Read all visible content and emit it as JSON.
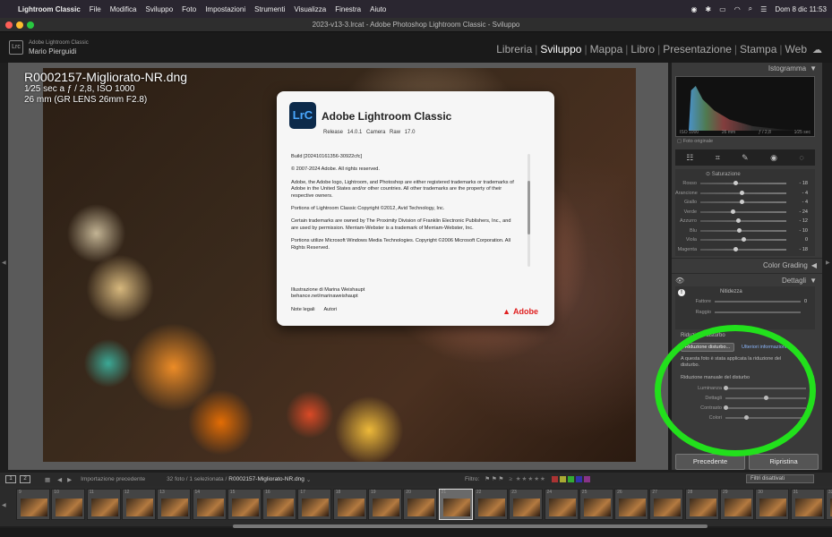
{
  "menubar": {
    "app": "Lightroom Classic",
    "items": [
      "File",
      "Modifica",
      "Sviluppo",
      "Foto",
      "Impostazioni",
      "Strumenti",
      "Visualizza",
      "Finestra",
      "Aiuto"
    ],
    "datetime": "Dom 8 dic  11:53"
  },
  "window": {
    "title": "2023-v13-3.lrcat - Adobe Photoshop Lightroom Classic - Sviluppo"
  },
  "identity": {
    "app_name": "Adobe Lightroom Classic",
    "user": "Mario Pierguidi",
    "logo": "Lrc"
  },
  "modules": [
    "Libreria",
    "Sviluppo",
    "Mappa",
    "Libro",
    "Presentazione",
    "Stampa",
    "Web"
  ],
  "active_module": "Sviluppo",
  "photo": {
    "filename": "R0002157-Migliorato-NR.dng",
    "exposure": "1⁄25 sec a ƒ / 2,8, ISO 1000",
    "lens": "26 mm (GR LENS 26mm F2.8)"
  },
  "about_dialog": {
    "icon_text": "LrC",
    "title": "Adobe Lightroom Classic",
    "release": "Release 14.0.1",
    "camera_raw": "Camera Raw 17.0",
    "paragraphs": [
      "Build [202410161356-30922cfc]",
      "© 2007-2024 Adobe. All rights reserved.",
      "Adobe, the Adobe logo, Lightroom, and Photoshop are either registered trademarks or trademarks of Adobe in the United States and/or other countries. All other trademarks are the property of their respective owners.",
      "Portions of Lightroom Classic Copyright ©2012, Avid Technology, Inc.",
      "Certain trademarks are owned by The Proximity Division of Franklin Electronic Publishers, Inc., and are used by permission. Merriam-Webster is a trademark of Merriam-Webster, Inc.",
      "Portions utilize Microsoft Windows Media Technologies. Copyright ©2006 Microsoft Corporation. All Rights Reserved."
    ],
    "credit_line1": "Illustrazione di Marina Weishaupt",
    "credit_line2": "behance.net/marinaweishaupt",
    "link_legal": "Note legali",
    "link_authors": "Autori",
    "brand": "Adobe",
    "scroll_progress": 0.45
  },
  "right_panel": {
    "histogram_title": "Istogramma",
    "histogram_info": {
      "iso": "ISO 1000",
      "focal": "26 mm",
      "aperture": "ƒ / 2,8",
      "shutter": "1⁄25 sec"
    },
    "original_photo_label": "Foto originale",
    "tool_icons": [
      "sliders-icon",
      "crop-icon",
      "heal-icon",
      "redeye-icon",
      "mask-icon"
    ],
    "saturation": {
      "title": "Saturazione",
      "rows": [
        {
          "label": "Rosso",
          "value": "- 18",
          "pos": 0.41
        },
        {
          "label": "Arancione",
          "value": "- 4",
          "pos": 0.48
        },
        {
          "label": "Giallo",
          "value": "- 4",
          "pos": 0.48
        },
        {
          "label": "Verde",
          "value": "- 24",
          "pos": 0.38
        },
        {
          "label": "Azzurro",
          "value": "- 12",
          "pos": 0.44
        },
        {
          "label": "Blu",
          "value": "- 10",
          "pos": 0.45
        },
        {
          "label": "Viola",
          "value": "0",
          "pos": 0.5
        },
        {
          "label": "Magenta",
          "value": "- 18",
          "pos": 0.41
        }
      ]
    },
    "color_grading": "Color Grading",
    "details": "Dettagli",
    "sharpening": {
      "title": "Nitidezza",
      "rows": [
        "Fattore",
        "Raggio"
      ],
      "factor_value": "0"
    },
    "noise": {
      "title": "Riduzione disturbo",
      "button": "Riduzione disturbo...",
      "more": "Ulteriori informazioni",
      "message": "A questa foto è stata applicata la riduzione del disturbo.",
      "manual": "Riduzione manuale del disturbo",
      "rows": [
        {
          "label": "Luminanza",
          "value": "0",
          "pos": 0.0
        },
        {
          "label": "Dettagli",
          "value": "",
          "pos": 0.5
        },
        {
          "label": "Contrasto",
          "value": "",
          "pos": 0.0
        },
        {
          "label": "Colori",
          "value": "",
          "pos": 0.25
        }
      ]
    },
    "prev_button": "Precedente",
    "reset_button": "Ripristina"
  },
  "filmstrip_bar": {
    "view1": "1",
    "view2": "2",
    "source": "Importazione precedente",
    "count": "32 foto / 1 selezionata /",
    "current_file": "R0002157-Migliorato-NR.dng",
    "filter_label": "Filtro:",
    "filter_value": "Filtri disattivati"
  },
  "filmstrip": {
    "numbers": [
      "9",
      "10",
      "11",
      "12",
      "13",
      "14",
      "15",
      "16",
      "17",
      "18",
      "19",
      "20",
      "21",
      "22",
      "23",
      "24",
      "25",
      "26",
      "27",
      "28",
      "29",
      "30",
      "31",
      "32"
    ],
    "selected_index": 12
  },
  "colors": {
    "highlight": "#22e01c",
    "adobe_red": "#e01f1f"
  }
}
